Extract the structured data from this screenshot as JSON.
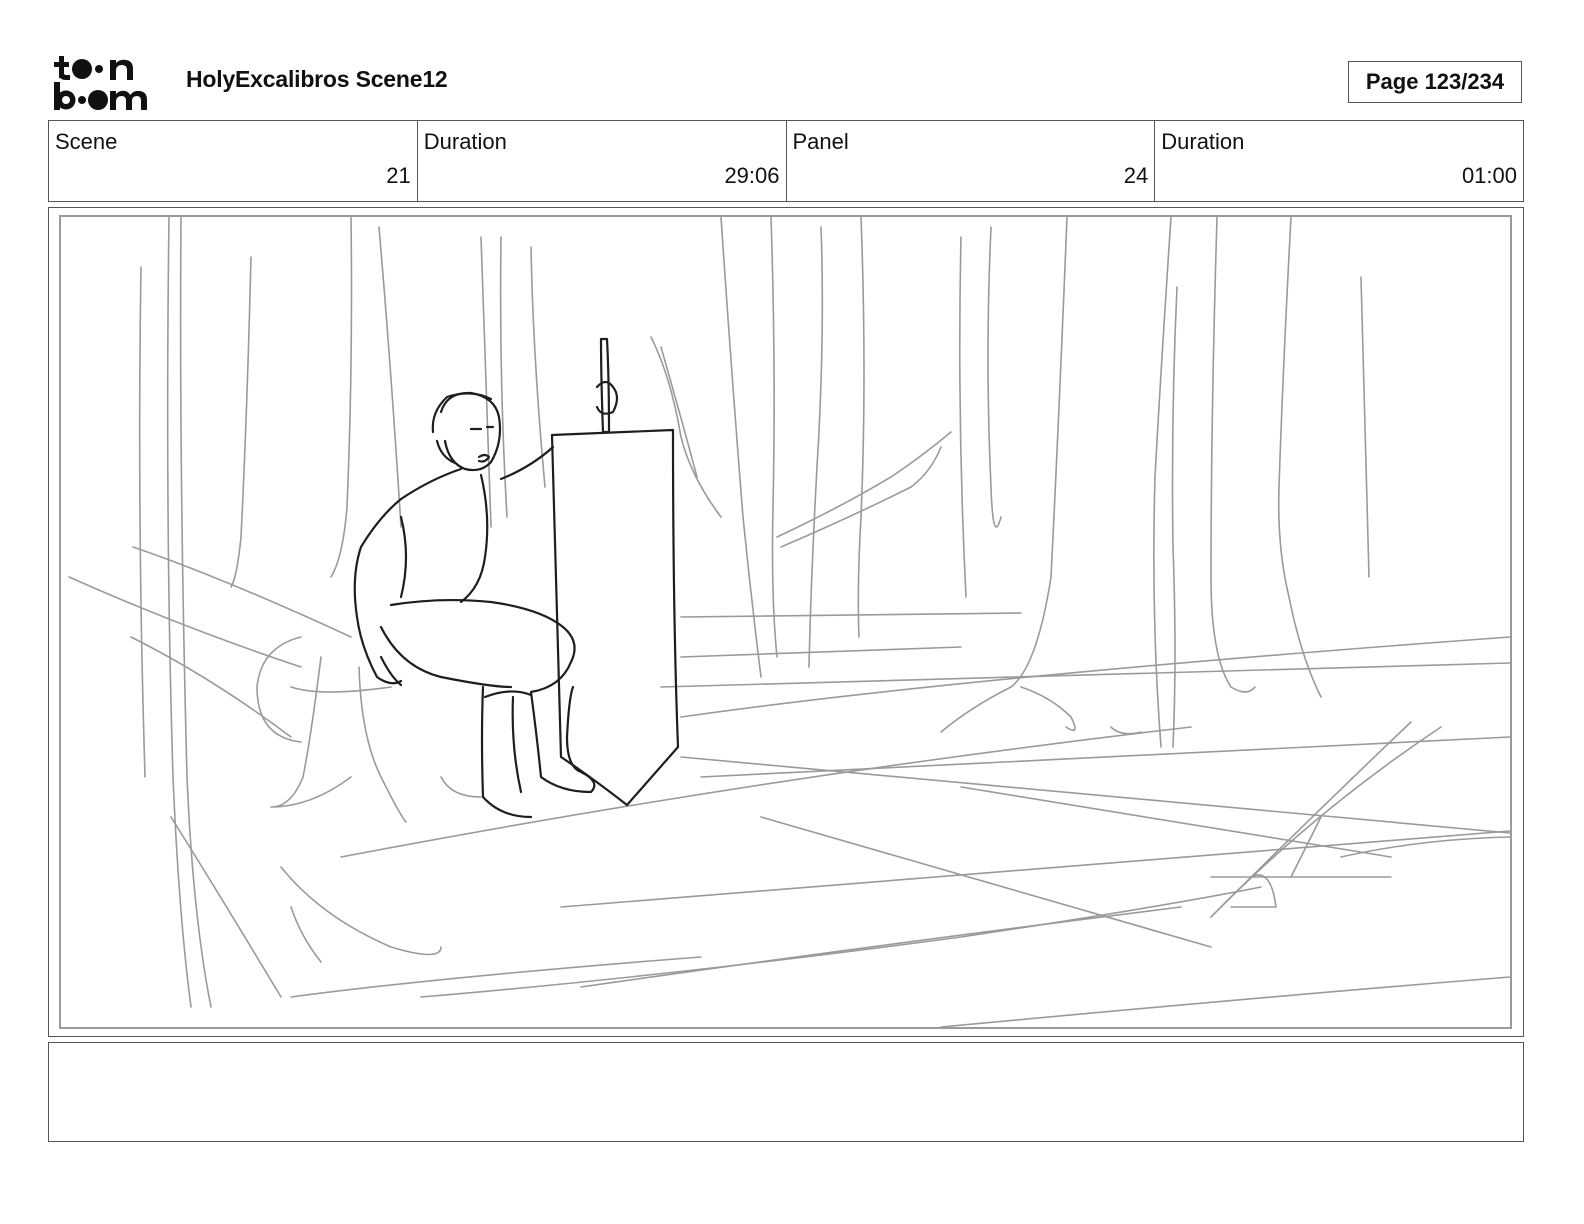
{
  "header": {
    "logo": {
      "name": "toon boom",
      "icon": "toonboom-logo"
    },
    "title": "HolyExcalibros Scene12",
    "page": "Page 123/234"
  },
  "info": [
    {
      "label": "Scene",
      "value": "21"
    },
    {
      "label": "Duration",
      "value": "29:06"
    },
    {
      "label": "Panel",
      "value": "24"
    },
    {
      "label": "Duration",
      "value": "01:00"
    }
  ],
  "panel": {
    "image": "pencil-sketch-forest-boy-sitting-with-shield-and-sword"
  },
  "notes": {
    "text": ""
  }
}
